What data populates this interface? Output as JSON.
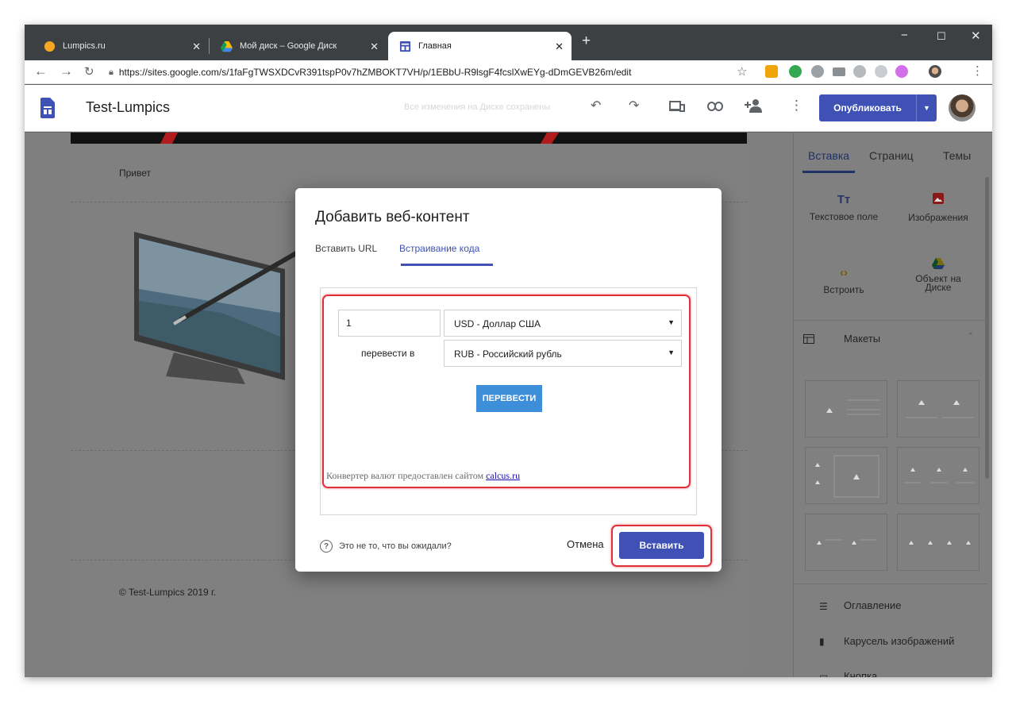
{
  "browser": {
    "tabs": [
      {
        "title": "Lumpics.ru",
        "favicon": "lumpics-icon"
      },
      {
        "title": "Мой диск – Google Диск",
        "favicon": "google-drive-icon"
      },
      {
        "title": "Главная",
        "favicon": "google-sites-icon"
      }
    ],
    "url": "https://sites.google.com/s/1faFgTWSXDCvR391tspP0v7hZMBOKT7VH/p/1EBbU-R9lsgF4fcslXwEYg-dDmGEVB26m/edit"
  },
  "header": {
    "site_title": "Test-Lumpics",
    "saved_status": "Все изменения на Диске сохранены",
    "publish_label": "Опубликовать"
  },
  "page": {
    "greeting": "Привет",
    "footer": "© Test-Lumpics 2019 г."
  },
  "side_panel": {
    "tabs": [
      "Вставка",
      "Страниц",
      "Темы"
    ],
    "tools": {
      "text_box": "Текстовое поле",
      "images": "Изображения",
      "embed": "Встроить",
      "drive_line1": "Объект на",
      "drive_line2": "Диске"
    },
    "layouts_title": "Макеты",
    "items": [
      "Оглавление",
      "Карусель изображений",
      "Кнопка"
    ]
  },
  "modal": {
    "title": "Добавить веб-контент",
    "tabs": [
      "Вставить URL",
      "Встраивание кода"
    ],
    "converter": {
      "amount": "1",
      "from_currency": "USD - Доллар США",
      "convert_to_label": "перевести в",
      "to_currency": "RUB - Российский рубль",
      "convert_button": "ПЕРЕВЕСТИ",
      "provider_text": "Конвертер валют предоставлен сайтом",
      "provider_link": "calcus.ru"
    },
    "help_text": "Это не то, что вы ожидали?",
    "cancel_label": "Отмена",
    "insert_label": "Вставить"
  },
  "colors": {
    "accent": "#3f51b5",
    "highlight": "#e0303a",
    "convert_button": "#3d8fd9"
  }
}
